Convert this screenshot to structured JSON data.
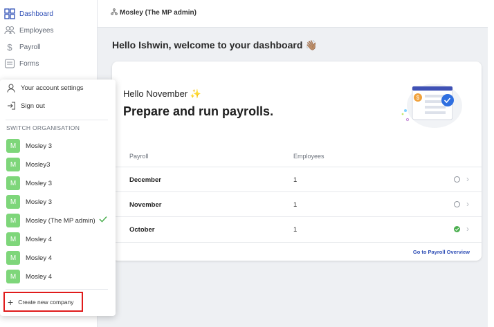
{
  "sidebar": {
    "items": [
      {
        "label": "Dashboard",
        "icon": "dashboard-icon",
        "active": true
      },
      {
        "label": "Employees",
        "icon": "people-icon"
      },
      {
        "label": "Payroll",
        "icon": "dollar-icon"
      },
      {
        "label": "Forms",
        "icon": "forms-icon"
      }
    ]
  },
  "topbar": {
    "org_name": "Mosley (The MP admin)",
    "org_icon": "org-tree-icon"
  },
  "greeting": "Hello Ishwin, welcome to your dashboard 👋🏽",
  "card": {
    "hello": "Hello November ✨",
    "title": "Prepare and run payrolls.",
    "columns": [
      "Payroll",
      "Employees"
    ],
    "rows": [
      {
        "month": "December",
        "employees": "1",
        "status": "open"
      },
      {
        "month": "November",
        "employees": "1",
        "status": "open"
      },
      {
        "month": "October",
        "employees": "1",
        "status": "done"
      }
    ],
    "overview_link": "Go to Payroll Overview"
  },
  "menu": {
    "account_settings": "Your account settings",
    "sign_out": "Sign out",
    "section_label": "SWITCH ORGANISATION",
    "orgs": [
      {
        "initial": "M",
        "name": "Mosley 3"
      },
      {
        "initial": "M",
        "name": "Mosley3"
      },
      {
        "initial": "M",
        "name": "Mosley 3"
      },
      {
        "initial": "M",
        "name": "Mosley 3"
      },
      {
        "initial": "M",
        "name": "Mosley (The MP admin)",
        "selected": true
      },
      {
        "initial": "M",
        "name": "Mosley 4"
      },
      {
        "initial": "M",
        "name": "Mosley 4"
      },
      {
        "initial": "M",
        "name": "Mosley 4"
      }
    ],
    "create_company": "Create new company"
  },
  "colors": {
    "accent": "#2d4db5",
    "avatar": "#7ed67a",
    "success": "#4caf50",
    "highlight": "#e01b1b"
  }
}
